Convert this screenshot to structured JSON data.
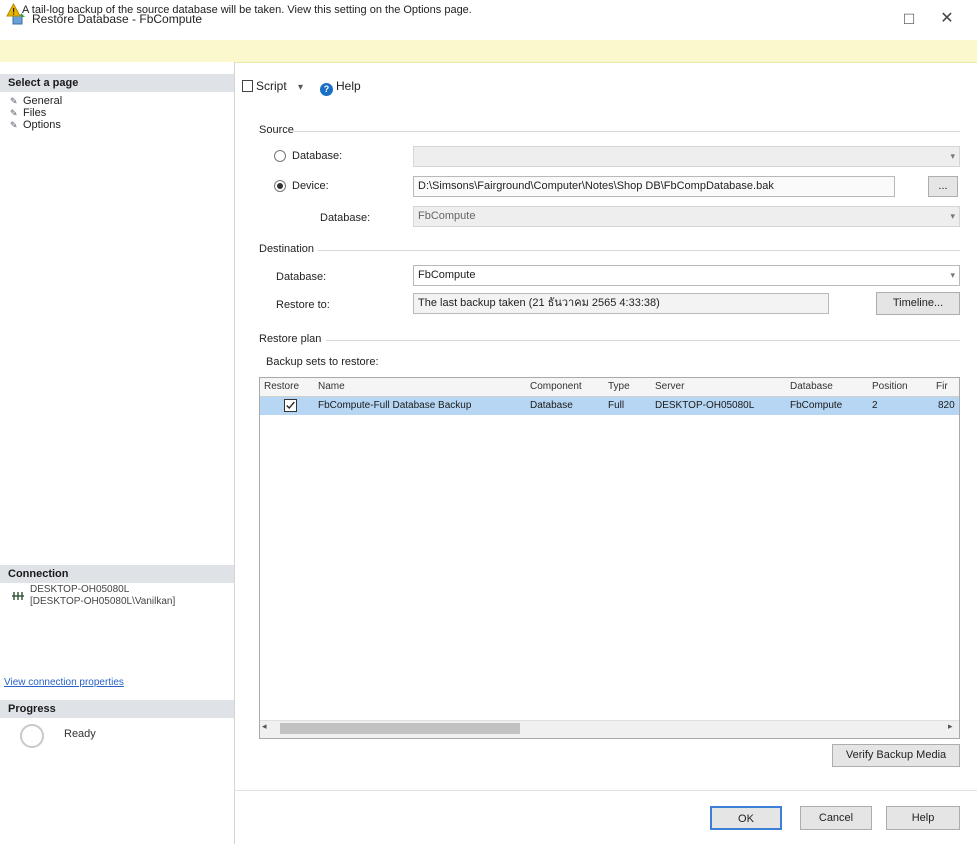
{
  "window": {
    "title": "Restore Database - FbCompute",
    "maximize_glyph": "☐",
    "close_glyph": "✕"
  },
  "warning": {
    "text": "A tail-log backup of the source database will be taken. View this setting on the Options page.",
    "icon": "warning-icon"
  },
  "left_pane": {
    "select_page_header": "Select a page",
    "pages": [
      {
        "label": "General",
        "icon": "wrench-icon"
      },
      {
        "label": "Files",
        "icon": "wrench-icon"
      },
      {
        "label": "Options",
        "icon": "wrench-icon"
      }
    ],
    "connection_header": "Connection",
    "connection_server": "DESKTOP-OH05080L",
    "connection_user": "[DESKTOP-OH05080L\\Vanilkan]",
    "connection_link": "View connection properties",
    "progress_header": "Progress",
    "progress_status": "Ready"
  },
  "toolbar": {
    "script_label": "Script",
    "script_arrow": "▾",
    "help_label": "Help"
  },
  "source": {
    "section_label": "Source",
    "database_radio_label": "Database:",
    "device_radio_label": "Device:",
    "database_field_value": "",
    "device_field_value": "D:\\Simsons\\Fairground\\Computer\\Notes\\Shop DB\\FbCompDatabase.bak",
    "device_browse_label": "...",
    "database_sub_label": "Database:",
    "database_sub_value": "FbCompute",
    "selected": "device"
  },
  "destination": {
    "section_label": "Destination",
    "database_label": "Database:",
    "database_value": "FbCompute",
    "restore_to_label": "Restore to:",
    "restore_to_value": "The last backup taken (21 ธันวาคม 2565 4:33:38)",
    "timeline_button": "Timeline..."
  },
  "restore_plan": {
    "section_label": "Restore plan",
    "sets_label": "Backup sets to restore:",
    "columns": [
      "Restore",
      "Name",
      "Component",
      "Type",
      "Server",
      "Database",
      "Position",
      "Fir"
    ],
    "rows": [
      {
        "restore": true,
        "name": "FbCompute-Full Database Backup",
        "component": "Database",
        "type": "Full",
        "server": "DESKTOP-OH05080L",
        "database": "FbCompute",
        "position": "2",
        "first": "820"
      }
    ],
    "verify_button": "Verify Backup Media"
  },
  "footer": {
    "ok_label": "OK",
    "cancel_label": "Cancel",
    "help_label": "Help"
  },
  "colors": {
    "warning_bg": "#fbf8cd",
    "selected_row": "#b7d6f3",
    "header_bg": "#dfe3e8",
    "help_icon": "#1a6fc4",
    "warning_icon": "#e8b400"
  }
}
